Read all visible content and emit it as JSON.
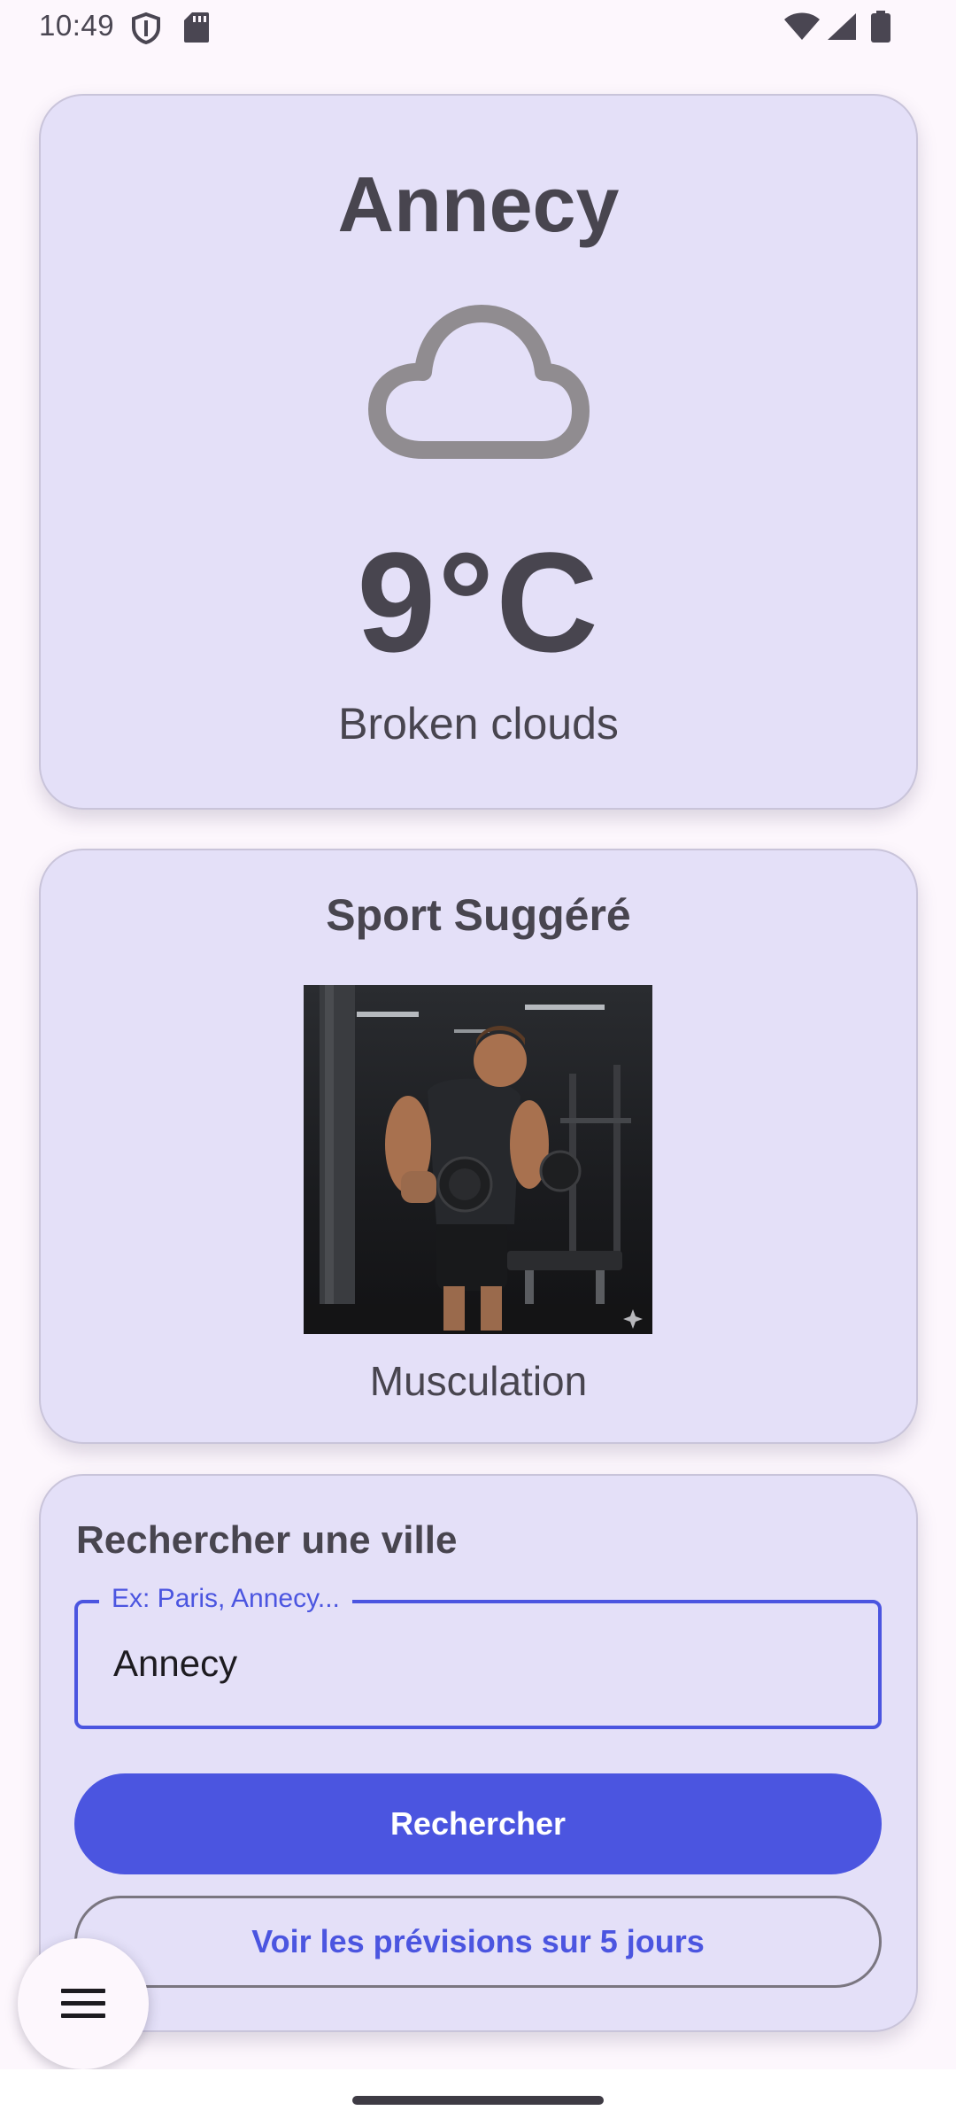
{
  "status_bar": {
    "time": "10:49"
  },
  "weather": {
    "city": "Annecy",
    "icon": "cloud-icon",
    "temperature": "9°C",
    "description": "Broken clouds"
  },
  "sport": {
    "title": "Sport Suggéré",
    "image": "weightlifting-photo",
    "name": "Musculation"
  },
  "search": {
    "title": "Rechercher une ville",
    "placeholder": "Ex: Paris, Annecy...",
    "value": "Annecy",
    "search_button": "Rechercher",
    "forecast_button": "Voir les prévisions sur 5 jours"
  },
  "fab": {
    "icon": "menu-icon"
  },
  "colors": {
    "primary": "#4b55e0",
    "card_background": "#e4e0f8",
    "text": "#48454f"
  }
}
